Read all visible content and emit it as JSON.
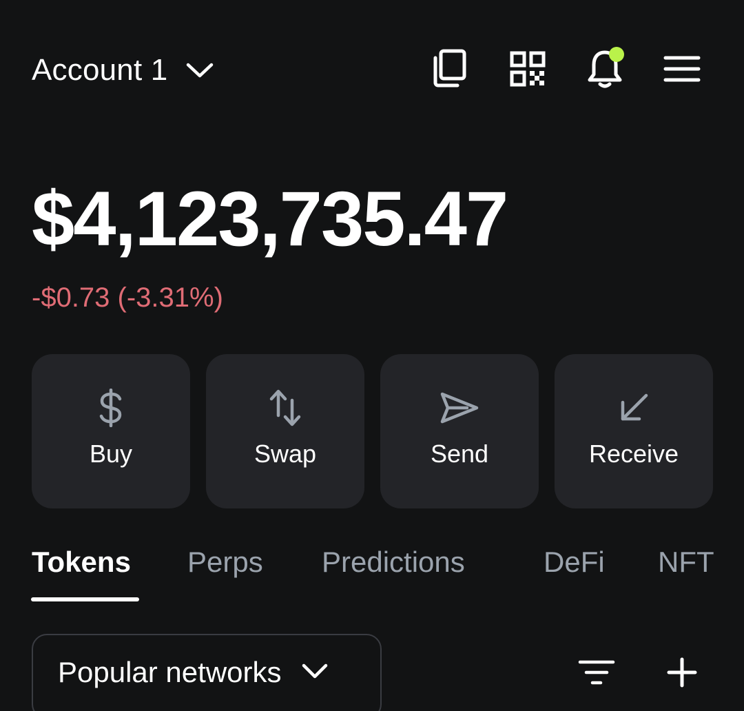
{
  "header": {
    "account_name": "Account 1",
    "icons": [
      "chevron-down-icon",
      "copy-icon",
      "qr-code-icon",
      "bell-icon",
      "menu-icon"
    ],
    "notification_dot_color": "#baf24a"
  },
  "portfolio": {
    "balance": "$4,123,735.47",
    "change": "-$0.73 (-3.31%)",
    "change_color": "#e06c75"
  },
  "actions": [
    {
      "label": "Buy",
      "icon": "dollar-icon"
    },
    {
      "label": "Swap",
      "icon": "swap-arrows-icon"
    },
    {
      "label": "Send",
      "icon": "send-icon"
    },
    {
      "label": "Receive",
      "icon": "receive-arrow-icon"
    }
  ],
  "tabs": [
    {
      "label": "Tokens",
      "active": true
    },
    {
      "label": "Perps",
      "active": false
    },
    {
      "label": "Predictions",
      "active": false
    },
    {
      "label": "DeFi",
      "active": false
    },
    {
      "label": "NFT",
      "active": false
    }
  ],
  "filters": {
    "network_label": "Popular networks",
    "icons": [
      "filter-icon",
      "plus-icon"
    ]
  }
}
